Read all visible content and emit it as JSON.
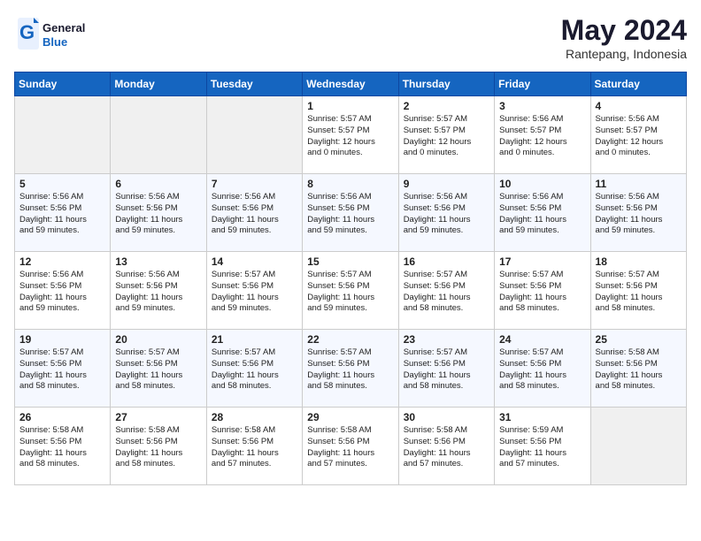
{
  "header": {
    "logo_line1": "General",
    "logo_line2": "Blue",
    "month_title": "May 2024",
    "location": "Rantepang, Indonesia"
  },
  "weekdays": [
    "Sunday",
    "Monday",
    "Tuesday",
    "Wednesday",
    "Thursday",
    "Friday",
    "Saturday"
  ],
  "weeks": [
    [
      {
        "day": "",
        "info": ""
      },
      {
        "day": "",
        "info": ""
      },
      {
        "day": "",
        "info": ""
      },
      {
        "day": "1",
        "info": "Sunrise: 5:57 AM\nSunset: 5:57 PM\nDaylight: 12 hours\nand 0 minutes."
      },
      {
        "day": "2",
        "info": "Sunrise: 5:57 AM\nSunset: 5:57 PM\nDaylight: 12 hours\nand 0 minutes."
      },
      {
        "day": "3",
        "info": "Sunrise: 5:56 AM\nSunset: 5:57 PM\nDaylight: 12 hours\nand 0 minutes."
      },
      {
        "day": "4",
        "info": "Sunrise: 5:56 AM\nSunset: 5:57 PM\nDaylight: 12 hours\nand 0 minutes."
      }
    ],
    [
      {
        "day": "5",
        "info": "Sunrise: 5:56 AM\nSunset: 5:56 PM\nDaylight: 11 hours\nand 59 minutes."
      },
      {
        "day": "6",
        "info": "Sunrise: 5:56 AM\nSunset: 5:56 PM\nDaylight: 11 hours\nand 59 minutes."
      },
      {
        "day": "7",
        "info": "Sunrise: 5:56 AM\nSunset: 5:56 PM\nDaylight: 11 hours\nand 59 minutes."
      },
      {
        "day": "8",
        "info": "Sunrise: 5:56 AM\nSunset: 5:56 PM\nDaylight: 11 hours\nand 59 minutes."
      },
      {
        "day": "9",
        "info": "Sunrise: 5:56 AM\nSunset: 5:56 PM\nDaylight: 11 hours\nand 59 minutes."
      },
      {
        "day": "10",
        "info": "Sunrise: 5:56 AM\nSunset: 5:56 PM\nDaylight: 11 hours\nand 59 minutes."
      },
      {
        "day": "11",
        "info": "Sunrise: 5:56 AM\nSunset: 5:56 PM\nDaylight: 11 hours\nand 59 minutes."
      }
    ],
    [
      {
        "day": "12",
        "info": "Sunrise: 5:56 AM\nSunset: 5:56 PM\nDaylight: 11 hours\nand 59 minutes."
      },
      {
        "day": "13",
        "info": "Sunrise: 5:56 AM\nSunset: 5:56 PM\nDaylight: 11 hours\nand 59 minutes."
      },
      {
        "day": "14",
        "info": "Sunrise: 5:57 AM\nSunset: 5:56 PM\nDaylight: 11 hours\nand 59 minutes."
      },
      {
        "day": "15",
        "info": "Sunrise: 5:57 AM\nSunset: 5:56 PM\nDaylight: 11 hours\nand 59 minutes."
      },
      {
        "day": "16",
        "info": "Sunrise: 5:57 AM\nSunset: 5:56 PM\nDaylight: 11 hours\nand 58 minutes."
      },
      {
        "day": "17",
        "info": "Sunrise: 5:57 AM\nSunset: 5:56 PM\nDaylight: 11 hours\nand 58 minutes."
      },
      {
        "day": "18",
        "info": "Sunrise: 5:57 AM\nSunset: 5:56 PM\nDaylight: 11 hours\nand 58 minutes."
      }
    ],
    [
      {
        "day": "19",
        "info": "Sunrise: 5:57 AM\nSunset: 5:56 PM\nDaylight: 11 hours\nand 58 minutes."
      },
      {
        "day": "20",
        "info": "Sunrise: 5:57 AM\nSunset: 5:56 PM\nDaylight: 11 hours\nand 58 minutes."
      },
      {
        "day": "21",
        "info": "Sunrise: 5:57 AM\nSunset: 5:56 PM\nDaylight: 11 hours\nand 58 minutes."
      },
      {
        "day": "22",
        "info": "Sunrise: 5:57 AM\nSunset: 5:56 PM\nDaylight: 11 hours\nand 58 minutes."
      },
      {
        "day": "23",
        "info": "Sunrise: 5:57 AM\nSunset: 5:56 PM\nDaylight: 11 hours\nand 58 minutes."
      },
      {
        "day": "24",
        "info": "Sunrise: 5:57 AM\nSunset: 5:56 PM\nDaylight: 11 hours\nand 58 minutes."
      },
      {
        "day": "25",
        "info": "Sunrise: 5:58 AM\nSunset: 5:56 PM\nDaylight: 11 hours\nand 58 minutes."
      }
    ],
    [
      {
        "day": "26",
        "info": "Sunrise: 5:58 AM\nSunset: 5:56 PM\nDaylight: 11 hours\nand 58 minutes."
      },
      {
        "day": "27",
        "info": "Sunrise: 5:58 AM\nSunset: 5:56 PM\nDaylight: 11 hours\nand 58 minutes."
      },
      {
        "day": "28",
        "info": "Sunrise: 5:58 AM\nSunset: 5:56 PM\nDaylight: 11 hours\nand 57 minutes."
      },
      {
        "day": "29",
        "info": "Sunrise: 5:58 AM\nSunset: 5:56 PM\nDaylight: 11 hours\nand 57 minutes."
      },
      {
        "day": "30",
        "info": "Sunrise: 5:58 AM\nSunset: 5:56 PM\nDaylight: 11 hours\nand 57 minutes."
      },
      {
        "day": "31",
        "info": "Sunrise: 5:59 AM\nSunset: 5:56 PM\nDaylight: 11 hours\nand 57 minutes."
      },
      {
        "day": "",
        "info": ""
      }
    ]
  ]
}
